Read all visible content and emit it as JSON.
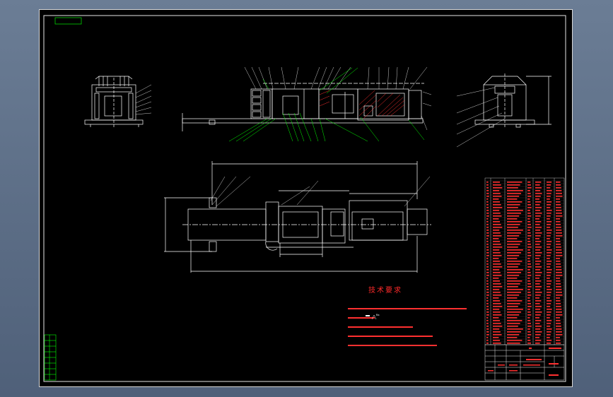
{
  "tech_requirements": {
    "title": "技术要求"
  },
  "surface_mark": "Ra",
  "colors": {
    "background": "#5b6e87",
    "sheet": "#000000",
    "frame": "#e6e6e6",
    "geometry": "#ffffff",
    "leader": "#00ff00",
    "text": "#ff3030",
    "hatch": "#ff3030"
  }
}
